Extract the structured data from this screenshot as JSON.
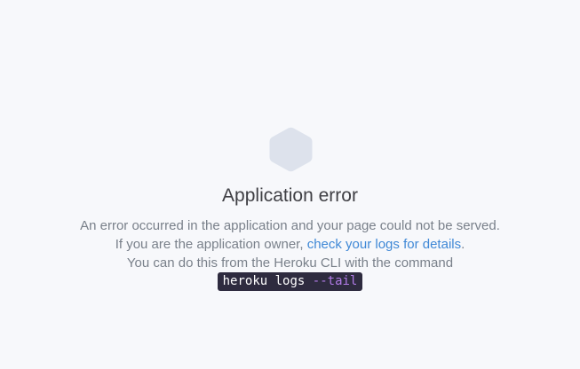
{
  "error": {
    "title": "Application error",
    "message_part1": "An error occurred in the application and your page could not be served. If you are the application owner, ",
    "logs_link": "check your logs for details",
    "message_part2": ".",
    "message_line3": "You can do this from the Heroku CLI with the command",
    "command_base": "heroku logs ",
    "command_flag": "--tail",
    "icon": "hexagon-icon"
  },
  "colors": {
    "background": "#f7f8fb",
    "hexagon": "#dde2ec",
    "link": "#3f88d6",
    "command_bg": "#2e2b3f",
    "command_flag": "#b27ce8"
  }
}
